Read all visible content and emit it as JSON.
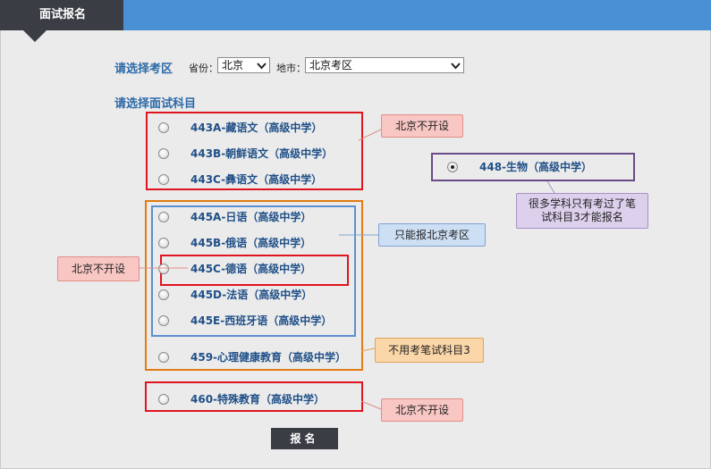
{
  "header": {
    "tab_label": "面试报名"
  },
  "region": {
    "section_label": "请选择考区",
    "province_label": "省份：",
    "province_value": "北京",
    "city_label": "地市：",
    "city_value": "北京考区"
  },
  "subjects": {
    "section_label": "请选择面试科目",
    "options": [
      "443A-藏语文（高级中学）",
      "443B-朝鲜语文（高级中学）",
      "443C-彝语文（高级中学）",
      "445A-日语（高级中学）",
      "445B-俄语（高级中学）",
      "445C-德语（高级中学）",
      "445D-法语（高级中学）",
      "445E-西班牙语（高级中学）",
      "459-心理健康教育（高级中学）",
      "460-特殊教育（高级中学）",
      "448-生物（高级中学）"
    ],
    "selected_index": 10
  },
  "annotations": {
    "not_offered_1": "北京不开设",
    "not_offered_2": "北京不开设",
    "not_offered_3": "北京不开设",
    "beijing_only": "只能报北京考区",
    "no_written_3": "不用考笔试科目3",
    "written_3_note": "很多学科只有考过了笔试科目3才能报名"
  },
  "submit_label": "报名",
  "colors": {
    "header_bar": "#4a90d4",
    "tab_bg": "#3a3d44",
    "label_blue": "#2c6aa8",
    "option_blue": "#1f4f88",
    "red": "#e0141e",
    "orange": "#e27b13",
    "blue": "#5b8fd0",
    "purple": "#6a4a87"
  }
}
